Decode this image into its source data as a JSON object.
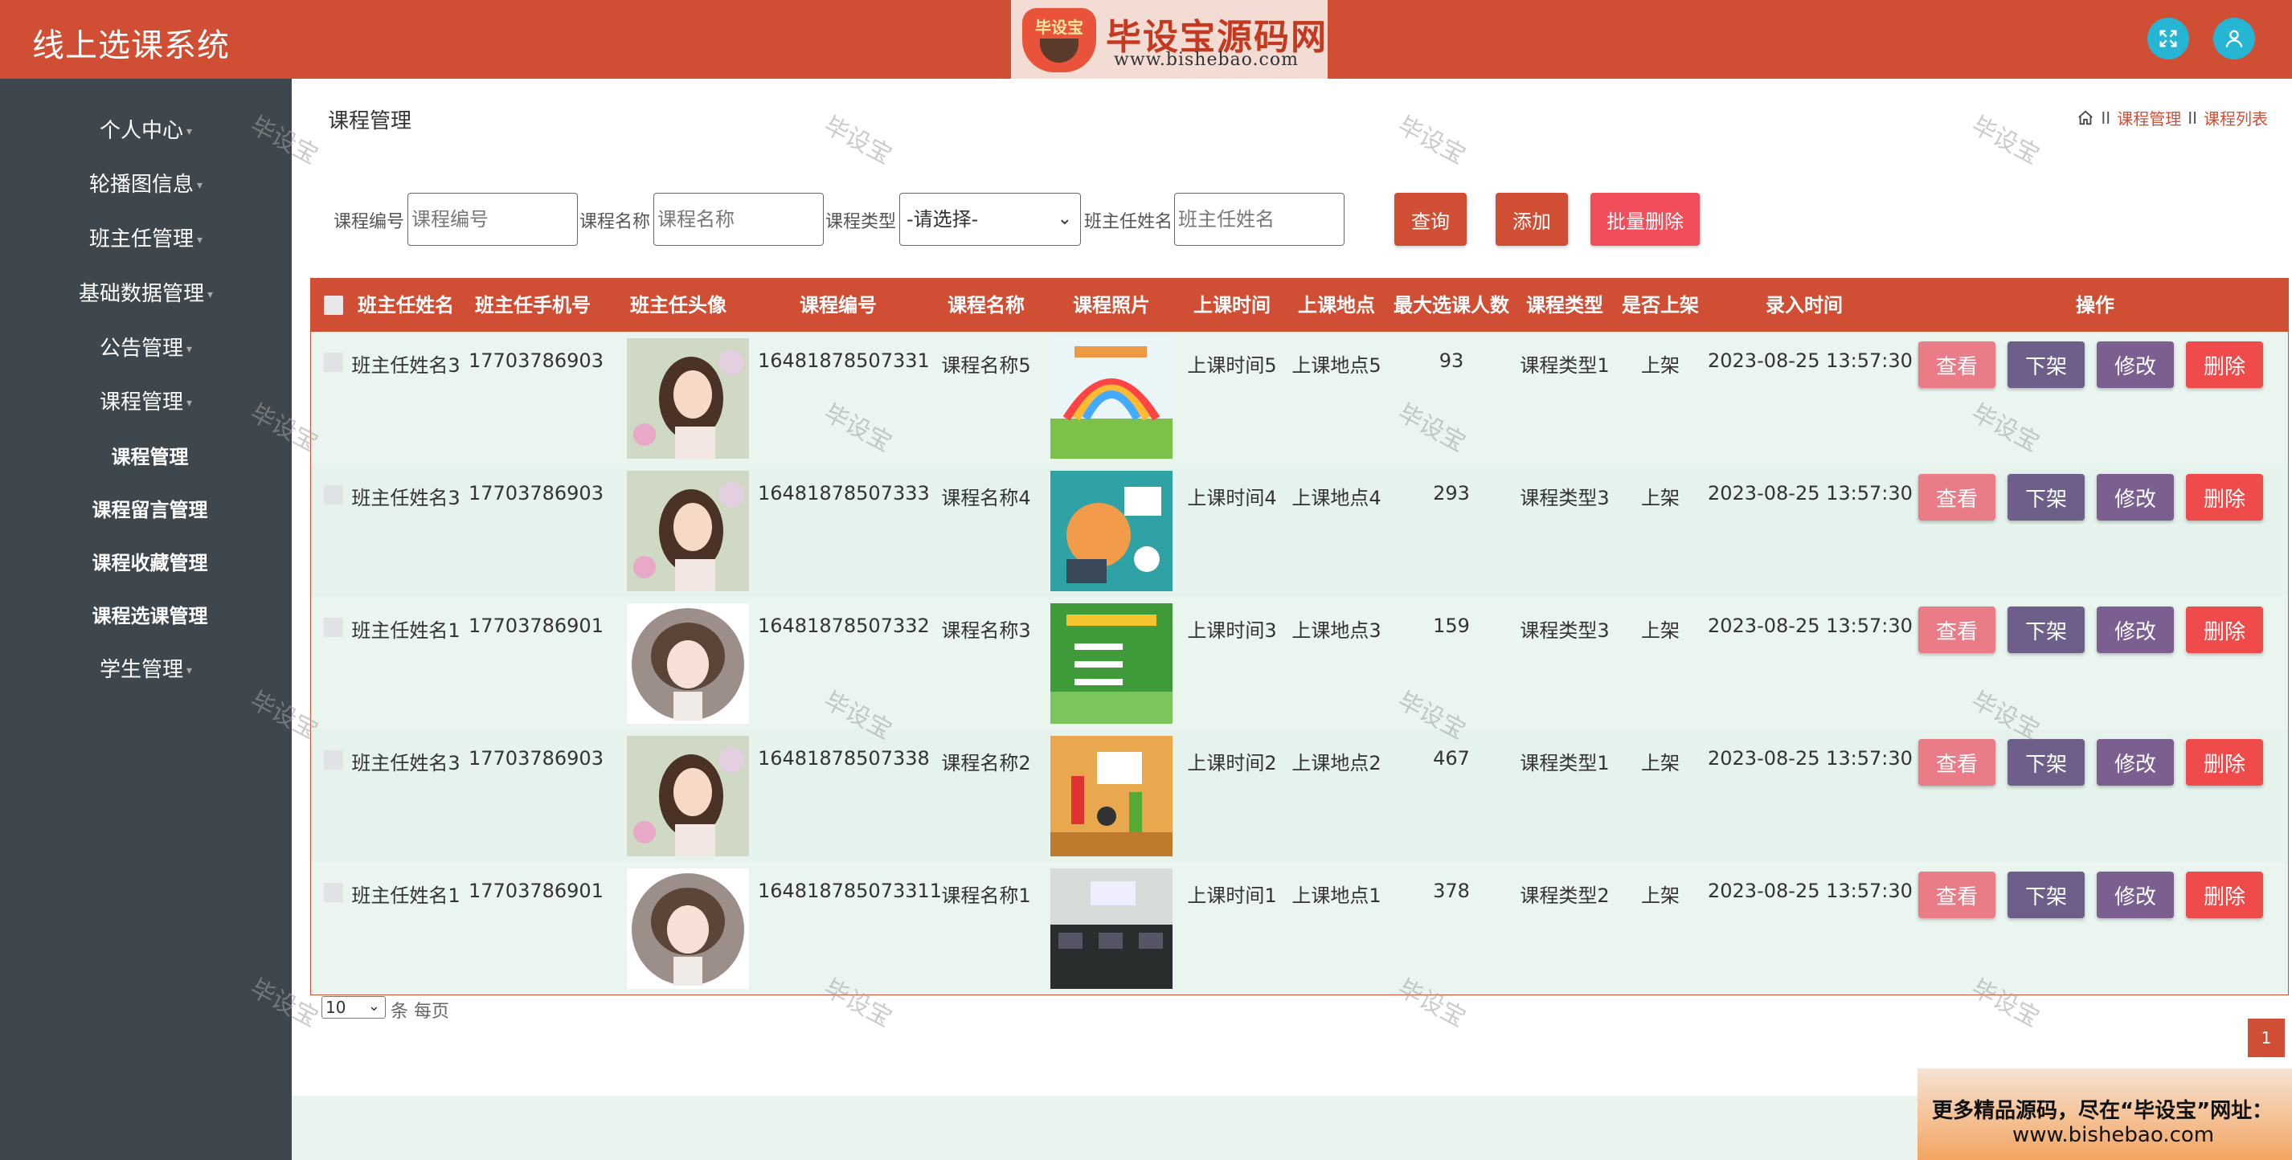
{
  "app": {
    "title": "线上选课系统",
    "logo_badge": "毕设宝",
    "logo_main": "毕设宝源码网",
    "logo_url": "www.bishebao.com"
  },
  "sidebar": {
    "items": [
      {
        "label": "个人中心",
        "caret": "▾"
      },
      {
        "label": "轮播图信息",
        "caret": "▾"
      },
      {
        "label": "班主任管理",
        "caret": "▾"
      },
      {
        "label": "基础数据管理",
        "caret": "▾"
      },
      {
        "label": "公告管理",
        "caret": "▾"
      },
      {
        "label": "课程管理",
        "caret": "▾"
      }
    ],
    "subitems": [
      "课程管理",
      "课程留言管理",
      "课程收藏管理",
      "课程选课管理"
    ],
    "last_item": {
      "label": "学生管理",
      "caret": "▾"
    }
  },
  "page": {
    "title": "课程管理",
    "breadcrumb": [
      "课程管理",
      "课程列表"
    ],
    "breadcrumb_sep": "II"
  },
  "search": {
    "course_no_label": "课程编号",
    "course_no_placeholder": "课程编号",
    "course_name_label": "课程名称",
    "course_name_placeholder": "课程名称",
    "course_type_label": "课程类型",
    "course_type_value": "-请选择-",
    "teacher_label": "班主任姓名",
    "teacher_placeholder": "班主任姓名",
    "query_button": "查询",
    "add_button": "添加",
    "batch_delete_button": "批量删除"
  },
  "table": {
    "headers": [
      "班主任姓名",
      "班主任手机号",
      "班主任头像",
      "课程编号",
      "课程名称",
      "课程照片",
      "上课时间",
      "上课地点",
      "最大选课人数",
      "课程类型",
      "是否上架",
      "录入时间",
      "操作"
    ],
    "row_actions": [
      "查看",
      "下架",
      "修改",
      "删除"
    ],
    "rows": [
      {
        "teacher": "班主任姓名3",
        "phone": "17703786903",
        "avatar": "photo-girl",
        "course_no": "16481878507331",
        "course_name": "课程名称5",
        "photo": "photo-rainbow-slide",
        "time": "上课时间5",
        "place": "上课地点5",
        "max": "93",
        "type": "课程类型1",
        "shelf": "上架",
        "created": "2023-08-25 13:57:30"
      },
      {
        "teacher": "班主任姓名3",
        "phone": "17703786903",
        "avatar": "photo-girl",
        "course_no": "16481878507333",
        "course_name": "课程名称4",
        "photo": "photo-teal-desk",
        "time": "上课时间4",
        "place": "上课地点4",
        "max": "293",
        "type": "课程类型3",
        "shelf": "上架",
        "created": "2023-08-25 13:57:30"
      },
      {
        "teacher": "班主任姓名1",
        "phone": "17703786901",
        "avatar": "illustration-girl",
        "course_no": "16481878507332",
        "course_name": "课程名称3",
        "photo": "photo-green-slide",
        "time": "上课时间3",
        "place": "上课地点3",
        "max": "159",
        "type": "课程类型3",
        "shelf": "上架",
        "created": "2023-08-25 13:57:30"
      },
      {
        "teacher": "班主任姓名3",
        "phone": "17703786903",
        "avatar": "photo-girl",
        "course_no": "16481878507338",
        "course_name": "课程名称2",
        "photo": "photo-classroom-kids",
        "time": "上课时间2",
        "place": "上课地点2",
        "max": "467",
        "type": "课程类型1",
        "shelf": "上架",
        "created": "2023-08-25 13:57:30"
      },
      {
        "teacher": "班主任姓名1",
        "phone": "17703786901",
        "avatar": "illustration-girl",
        "course_no": "164818785073311",
        "course_name": "课程名称1",
        "photo": "photo-computer-lab",
        "time": "上课时间1",
        "place": "上课地点1",
        "max": "378",
        "type": "课程类型2",
        "shelf": "上架",
        "created": "2023-08-25 13:57:30"
      }
    ]
  },
  "pager": {
    "page_size": "10",
    "page_size_suffix": "条 每页",
    "current_page": "1"
  },
  "promo": {
    "line1": "更多精品源码，尽在“毕设宝”网址：",
    "line2": "www.bishebao.com"
  },
  "watermark": "毕设宝",
  "colors": {
    "primary": "#d04e34",
    "sidebar": "#3e474d",
    "view": "#ea7c88",
    "offshelf": "#6e5f8a",
    "edit": "#7a5f90",
    "delete": "#f04b4b",
    "batch_delete": "#f14d5a",
    "icon_bg": "#26b6d3"
  }
}
